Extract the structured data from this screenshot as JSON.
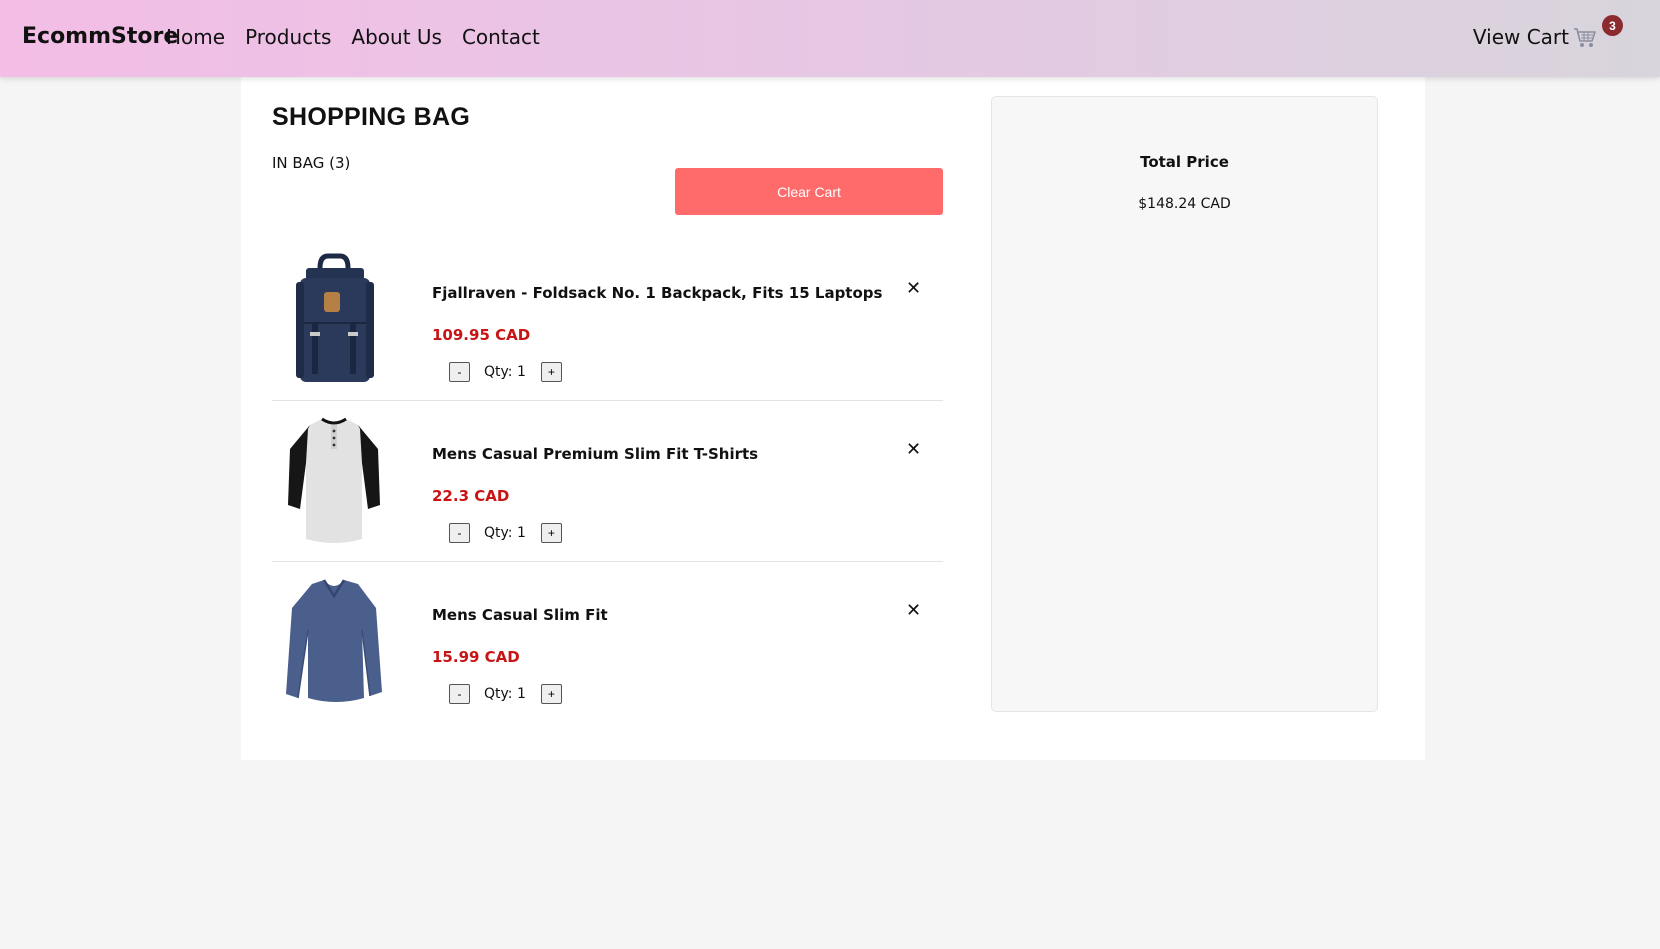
{
  "nav": {
    "brand": "EcommStore",
    "links": [
      "Home",
      "Products",
      "About Us",
      "Contact"
    ],
    "cart_label": "View Cart",
    "cart_icon": "shopping-cart-icon",
    "cart_count": "3"
  },
  "bag": {
    "title": "SHOPPING BAG",
    "in_bag": "IN BAG (3)",
    "clear_label": "Clear Cart",
    "clear_color": "#ff6b6b",
    "items": [
      {
        "title": "Fjallraven - Foldsack No. 1 Backpack, Fits 15 Laptops",
        "price": "109.95 CAD",
        "qty": "Qty: 1",
        "remove": "✕",
        "minus": "-",
        "plus": "+",
        "image": "backpack-image"
      },
      {
        "title": "Mens Casual Premium Slim Fit T-Shirts",
        "price": "22.3 CAD",
        "qty": "Qty: 1",
        "remove": "✕",
        "minus": "-",
        "plus": "+",
        "image": "raglan-shirt-image"
      },
      {
        "title": "Mens Casual Slim Fit",
        "price": "15.99 CAD",
        "qty": "Qty: 1",
        "remove": "✕",
        "minus": "-",
        "plus": "+",
        "image": "long-sleeve-shirt-image"
      }
    ],
    "price_color": "#c81414"
  },
  "summary": {
    "total_label": "Total Price",
    "total_value": "$148.24 CAD"
  }
}
